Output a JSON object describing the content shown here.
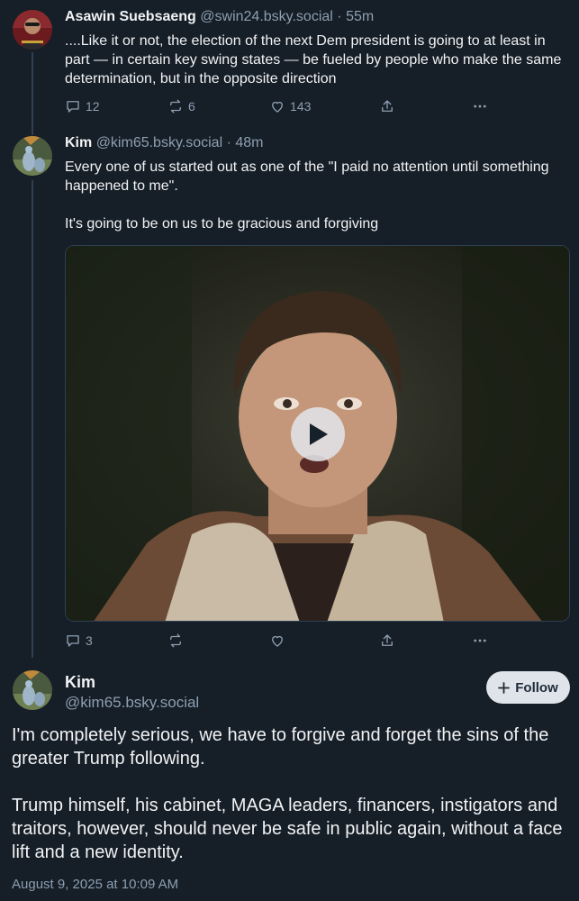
{
  "posts": [
    {
      "author": "Asawin Suebsaeng",
      "handle": "@swin24.bsky.social",
      "dot": "·",
      "time": "55m",
      "text": "....Like it or not, the election of the next Dem president is going to at least in part — in certain key swing states — be fueled by people who make the same determination, but in the opposite direction",
      "replies": "12",
      "reposts": "6",
      "likes": "143"
    },
    {
      "author": "Kim",
      "handle": "@kim65.bsky.social",
      "dot": "·",
      "time": "48m",
      "text": "Every one of us started out as one of the \"I paid no attention until something happened to me\".\n\nIt's going to be on us to be gracious and forgiving",
      "replies": "3",
      "reposts": "",
      "likes": ""
    }
  ],
  "main": {
    "author": "Kim",
    "handle": "@kim65.bsky.social",
    "follow_label": "Follow",
    "text": "I'm completely serious, we have to forgive and forget the sins of the greater Trump following.\n\nTrump himself, his cabinet, MAGA leaders, financers, instigators and traitors, however, should never be safe in public again, without a face lift and a new identity.",
    "timestamp": "August 9, 2025 at 10:09 AM"
  },
  "colors": {
    "background": "#161e27",
    "muted_text": "#8d9fb1",
    "follow_button": "#dfe4ea"
  },
  "icons": [
    "reply-icon",
    "repost-icon",
    "like-icon",
    "share-icon",
    "more-icon",
    "play-icon",
    "plus-icon"
  ]
}
